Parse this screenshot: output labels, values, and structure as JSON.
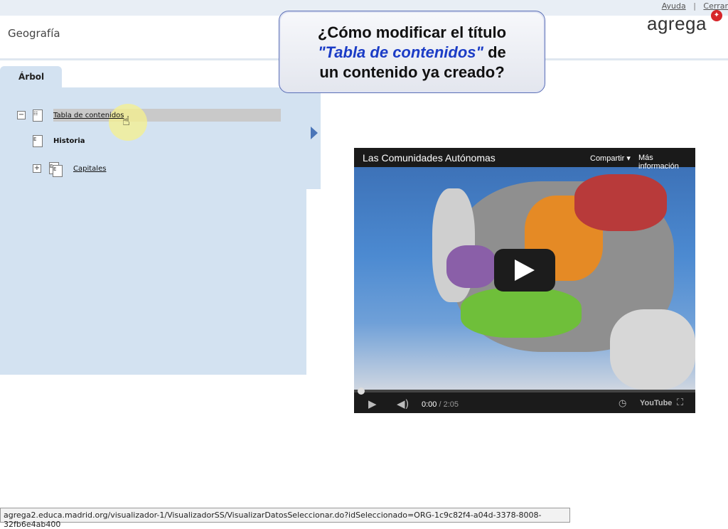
{
  "top_links": {
    "help": "Ayuda",
    "separator": "|",
    "close": "Cerrar"
  },
  "header": {
    "title": "Geografía",
    "logo": "agrega"
  },
  "tab": {
    "label": "Árbol"
  },
  "tree": {
    "items": [
      {
        "label": "Tabla de contenidos",
        "expand": "−"
      },
      {
        "label": "Historia"
      },
      {
        "label": "Capitales",
        "expand": "+"
      }
    ]
  },
  "callout": {
    "line1": "¿Cómo modificar el título",
    "line2_em": "\"Tabla de contenidos\"",
    "line2_rest": " de",
    "line3": "un contenido ya creado?"
  },
  "video": {
    "title": "Las Comunidades Autónomas",
    "share": "Compartir",
    "more_info": "Más información",
    "time_current": "0:00",
    "time_total": "/ 2:05",
    "logo": "YouTube"
  },
  "status_bar": {
    "url": "agrega2.educa.madrid.org/visualizador-1/VisualizadorSS/VisualizarDatosSeleccionar.do?idSeleccionado=ORG-1c9c82f4-a04d-3378-8008-32fb6e4ab400"
  },
  "colors": {
    "panel": "#d3e2f1",
    "accent": "#4a75b8",
    "logo_dot": "#d6262b",
    "callout_emphasis": "#1b3cc6"
  }
}
